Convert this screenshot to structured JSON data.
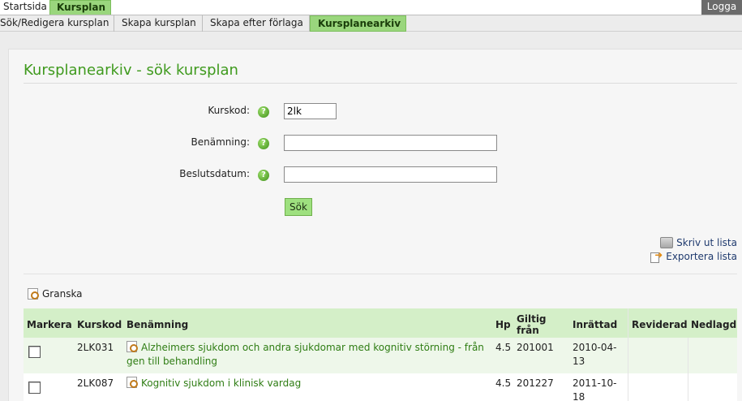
{
  "topnav": {
    "items": [
      {
        "label": "Startsida"
      },
      {
        "label": "Kursplan"
      }
    ],
    "logout": "Logga"
  },
  "subnav": {
    "items": [
      {
        "label": "Sök/Redigera kursplan"
      },
      {
        "label": "Skapa kursplan"
      },
      {
        "label": "Skapa efter förlaga"
      },
      {
        "label": "Kursplanearkiv"
      }
    ]
  },
  "page": {
    "title": "Kursplanearkiv - sök kursplan"
  },
  "form": {
    "kurskod": {
      "label": "Kurskod:",
      "value": "2lk"
    },
    "benamning": {
      "label": "Benämning:",
      "value": ""
    },
    "beslutsdatum": {
      "label": "Beslutsdatum:",
      "value": ""
    },
    "help_glyph": "?",
    "submit": "Sök"
  },
  "tools": {
    "print": "Skriv ut lista",
    "export": "Exportera lista",
    "granska": "Granska"
  },
  "table": {
    "headers": {
      "markera": "Markera",
      "kurskod": "Kurskod",
      "benamning": "Benämning",
      "hp": "Hp",
      "giltig": "Giltig från",
      "inrattad": "Inrättad",
      "reviderad": "Reviderad",
      "nedlagd": "Nedlagd"
    },
    "rows": [
      {
        "kurskod": "2LK031",
        "benamning": "Alzheimers sjukdom och andra sjukdomar med kognitiv störning - från gen till behandling",
        "hp": "4.5",
        "giltig": "201001",
        "inrattad": "2010-04-13",
        "reviderad": "",
        "nedlagd": ""
      },
      {
        "kurskod": "2LK087",
        "benamning": "Kognitiv sjukdom i klinisk vardag",
        "hp": "4.5",
        "giltig": "201227",
        "inrattad": "2011-10-18",
        "reviderad": "",
        "nedlagd": ""
      }
    ]
  },
  "colors": {
    "accent_green": "#3f9a1e",
    "tab_active": "#9ad67d",
    "table_header": "#d4efc8",
    "link_green": "#2f7d14",
    "logout_bg": "#6b6b6b"
  }
}
